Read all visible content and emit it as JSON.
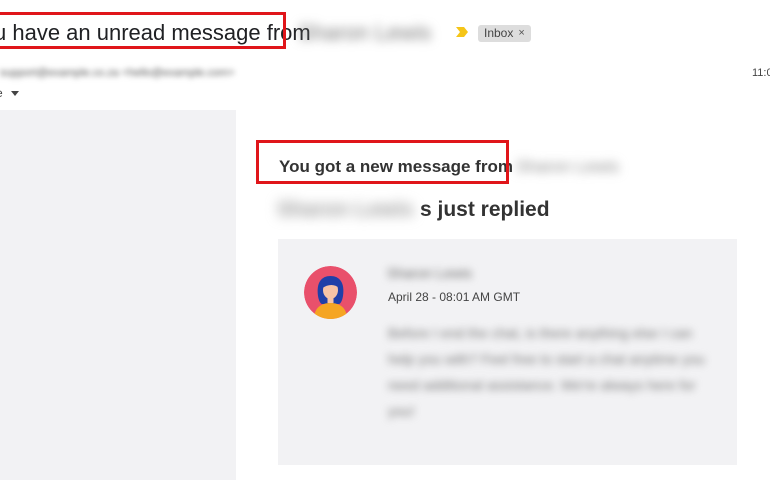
{
  "email": {
    "subject_visible": "u have an unread message from",
    "subject_hidden": "Sharon Lewis",
    "label_chip": "Inbox",
    "label_close": "×",
    "sender": "support@example.co.za <hello@example.com>",
    "time": "11:0",
    "to_me": "e"
  },
  "body": {
    "heading_visible": "You got a new message from",
    "heading_hidden": "Sharon Lewis",
    "replied_hidden": "Sharon Lewis",
    "replied_visible": "s just replied",
    "card": {
      "agent_name": "Sharon Lewis",
      "date": "April 28 - 08:01 AM GMT",
      "message": "Before I end the chat, is there anything else I can help you with? Feel free to start a chat anytime you need additional assistance. We're always here for you!"
    }
  },
  "icons": {
    "importance": "importance-marker-icon",
    "avatar": "agent-avatar"
  },
  "colors": {
    "highlight": "#e0151a",
    "importance": "#f5c518",
    "avatar_bg": "#e9506b",
    "card_bg": "#f2f2f4"
  }
}
